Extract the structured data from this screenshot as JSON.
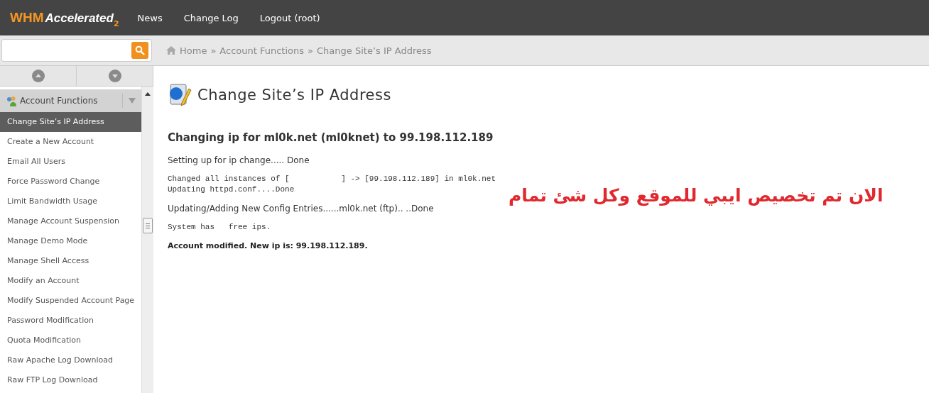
{
  "header": {
    "logo": {
      "main": "WHM",
      "script": "Accelerated",
      "version": "2"
    },
    "nav": [
      "News",
      "Change Log",
      "Logout (root)"
    ]
  },
  "breadcrumb": [
    "Home",
    "Account Functions",
    "Change Site’s IP Address"
  ],
  "breadcrumb_separator": "»",
  "sidebar": {
    "section": {
      "label": "Account Functions",
      "expanded": true
    },
    "items": [
      {
        "label": "Change Site’s IP Address",
        "selected": true
      },
      {
        "label": "Create a New Account",
        "selected": false
      },
      {
        "label": "Email All Users",
        "selected": false
      },
      {
        "label": "Force Password Change",
        "selected": false
      },
      {
        "label": "Limit Bandwidth Usage",
        "selected": false
      },
      {
        "label": "Manage Account Suspension",
        "selected": false
      },
      {
        "label": "Manage Demo Mode",
        "selected": false
      },
      {
        "label": "Manage Shell Access",
        "selected": false
      },
      {
        "label": "Modify an Account",
        "selected": false
      },
      {
        "label": "Modify Suspended Account Page",
        "selected": false
      },
      {
        "label": "Password Modification",
        "selected": false
      },
      {
        "label": "Quota Modification",
        "selected": false
      },
      {
        "label": "Raw Apache Log Download",
        "selected": false
      },
      {
        "label": "Raw FTP Log Download",
        "selected": false
      }
    ]
  },
  "page": {
    "title": "Change Site’s IP Address",
    "heading": "Changing ip for ml0k.net (ml0knet) to 99.198.112.189",
    "output": [
      {
        "kind": "text",
        "lines": [
          "Setting up for ip change..... Done"
        ]
      },
      {
        "kind": "mono",
        "lines": [
          "Changed all instances of [           ] -> [99.198.112.189] in ml0k.net",
          "Updating httpd.conf....Done"
        ]
      },
      {
        "kind": "text",
        "lines": [
          "Updating/Adding New Config Entries......ml0k.net (ftp).. ..Done"
        ]
      },
      {
        "kind": "mono",
        "lines": [
          "System has   free ips."
        ]
      },
      {
        "kind": "bold",
        "lines": [
          "Account modified. New ip is: 99.198.112.189."
        ]
      }
    ]
  },
  "annotation": "الان تم تخصيص ايبي للموقع وكل شئ تمام"
}
